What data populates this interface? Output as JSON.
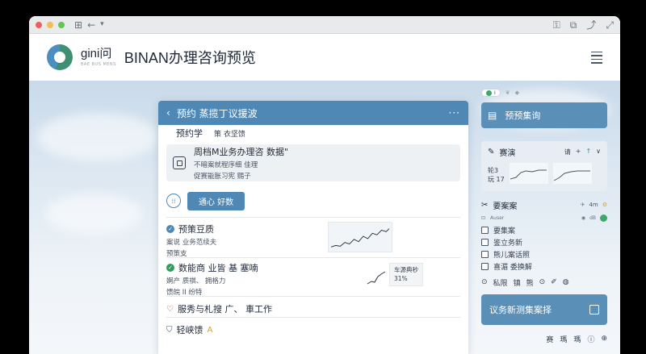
{
  "window": {
    "toolbar_icons": [
      "new-tab-icon",
      "back-arrow-icon",
      "lock-icon",
      "copy-icon",
      "share-icon",
      "fullscreen-icon"
    ],
    "traffic_lights": [
      "#ee5f57",
      "#f5bd4f",
      "#61c454"
    ]
  },
  "header": {
    "logo_name": "gini问",
    "logo_sub": "BAE BUS MENS",
    "title": "BINAN办理咨询预览"
  },
  "main_card": {
    "title": "预约 蒸揽丁议援波",
    "more": "···",
    "tab_label": "预约学",
    "tab_sub": "策 衣坚馈",
    "biz": {
      "title": "周档M业务办理咨  数据\"",
      "line1": "不暗案就程序细  佳理",
      "line2": "促赛能胀习宪    赐子"
    },
    "quick_label": "通心 好数",
    "rows": [
      {
        "title": "预策豆质",
        "line1": "案说   业务范续夫",
        "line2": "预策支"
      },
      {
        "title": "数能商 业皆 基 塞喃",
        "line1": "婀产 质祺、 拥格力",
        "line2": "馈皖 II 纷特",
        "badge_line1": "车源典秒",
        "badge_line2": "31%"
      },
      {
        "title": "服秀与札搜  广、 車工作"
      },
      {
        "title": "轻峡馈"
      }
    ]
  },
  "side": {
    "toggle_text": "I",
    "card1_title": "预预集询",
    "card2": {
      "title": "赛演",
      "ctrl": [
        "请",
        "+",
        "↑",
        "∨"
      ],
      "line1": "轮3",
      "line2": "玩 17"
    },
    "list": {
      "title": "要案案",
      "head_right": [
        "4m",
        "⚙"
      ],
      "sub_left": "Auser",
      "sub_right": "dB",
      "items": [
        "要集案",
        "鉴立务新",
        "熊儿案话照",
        "喜湄  委换解"
      ],
      "foot": [
        "私限",
        "镇",
        "熊",
        "⊙"
      ]
    },
    "cta": "议务新测集案择",
    "foot": [
      "赛",
      "瑪",
      "瑪"
    ]
  },
  "colors": {
    "accent": "#4f88b4",
    "green": "#2e9e5b",
    "heart": "#c0392b"
  }
}
